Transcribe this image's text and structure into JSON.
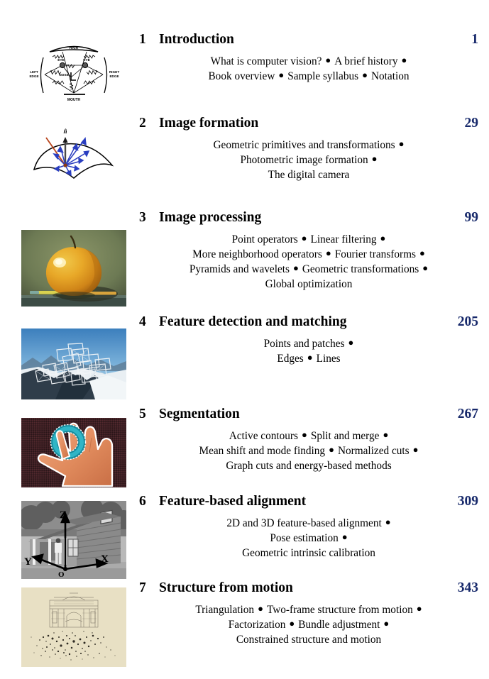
{
  "document": {
    "type": "book-table-of-contents",
    "page_number_color": "#17296b",
    "heading_color": "#000000",
    "background": "#ffffff"
  },
  "chapters": [
    {
      "number": "1",
      "title": "Introduction",
      "page": "1",
      "thumbnail": "pictorial-structures-face-model-diagram",
      "thumbnail_labels": [
        "HAIR",
        "EYE",
        "EYE",
        "LEFT EDGE",
        "NOSE",
        "RIGHT EDGE",
        "MOUTH"
      ],
      "topic_lines": [
        [
          "What is computer vision?",
          "A brief history"
        ],
        [
          "Book overview",
          "Sample syllabus",
          "Notation"
        ]
      ],
      "trailing_bullet": [
        true,
        false
      ]
    },
    {
      "number": "2",
      "title": "Image formation",
      "page": "29",
      "thumbnail": "brdf-surface-reflection-diagram",
      "thumbnail_labels": [
        "n"
      ],
      "topic_lines": [
        [
          "Geometric primitives and transformations"
        ],
        [
          "Photometric image formation"
        ],
        [
          "The digital camera"
        ]
      ],
      "trailing_bullet": [
        true,
        true,
        false
      ]
    },
    {
      "number": "3",
      "title": "Image processing",
      "page": "99",
      "thumbnail": "apple-still-life-photograph",
      "thumbnail_labels": [],
      "topic_lines": [
        [
          "Point operators",
          "Linear filtering"
        ],
        [
          "More neighborhood operators",
          "Fourier transforms"
        ],
        [
          "Pyramids and wavelets",
          "Geometric transformations"
        ],
        [
          "Global optimization"
        ]
      ],
      "trailing_bullet": [
        true,
        true,
        true,
        false
      ]
    },
    {
      "number": "4",
      "title": "Feature detection and matching",
      "page": "205",
      "thumbnail": "feature-patches-on-mountain-photograph",
      "thumbnail_labels": [],
      "topic_lines": [
        [
          "Points and patches"
        ],
        [
          "Edges",
          "Lines"
        ]
      ],
      "trailing_bullet": [
        true,
        false
      ]
    },
    {
      "number": "5",
      "title": "Segmentation",
      "page": "267",
      "thumbnail": "segmented-hand-with-ring-photograph",
      "thumbnail_labels": [],
      "topic_lines": [
        [
          "Active contours",
          "Split and merge"
        ],
        [
          "Mean shift and mode finding",
          "Normalized cuts"
        ],
        [
          "Graph cuts and energy-based methods"
        ]
      ],
      "trailing_bullet": [
        true,
        true,
        false
      ]
    },
    {
      "number": "6",
      "title": "Feature-based alignment",
      "page": "309",
      "thumbnail": "house-with-xyz-coordinate-axes-photograph",
      "thumbnail_labels": [
        "Z",
        "Y",
        "X",
        "O"
      ],
      "topic_lines": [
        [
          "2D and 3D feature-based alignment"
        ],
        [
          "Pose estimation"
        ],
        [
          "Geometric intrinsic calibration"
        ]
      ],
      "trailing_bullet": [
        true,
        true,
        false
      ]
    },
    {
      "number": "7",
      "title": "Structure from motion",
      "page": "343",
      "thumbnail": "sparse-3d-point-cloud-reconstruction",
      "thumbnail_labels": [],
      "topic_lines": [
        [
          "Triangulation",
          "Two-frame structure from motion"
        ],
        [
          "Factorization",
          "Bundle adjustment"
        ],
        [
          "Constrained structure and motion"
        ]
      ],
      "trailing_bullet": [
        true,
        true,
        false
      ]
    }
  ],
  "glyphs": {
    "bullet": "●"
  }
}
